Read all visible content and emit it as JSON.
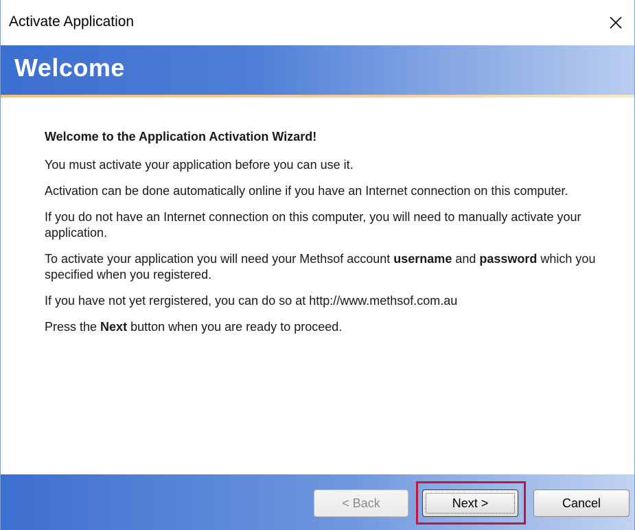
{
  "window": {
    "title": "Activate Application",
    "close_icon": "close-icon"
  },
  "banner": {
    "title": "Welcome"
  },
  "content": {
    "heading": "Welcome to the Application Activation Wizard!",
    "p1": "You must activate your application before you can use it.",
    "p2": "Activation can be done automatically online if you have an Internet connection on this computer.",
    "p3": "If you do not have an Internet connection on this computer, you will need to manually activate your application.",
    "p4_part1": "To activate your application you will need your Methsof account ",
    "p4_bold1": "username",
    "p4_part2": " and ",
    "p4_bold2": "password",
    "p4_part3": " which you specified when you registered.",
    "p5": "If you have not yet rergistered, you can do so at http://www.methsof.com.au",
    "p6_part1": "Press the ",
    "p6_bold": "Next",
    "p6_part2": " button when you are ready to proceed."
  },
  "footer": {
    "back_label": "< Back",
    "next_label": "Next >",
    "cancel_label": "Cancel"
  },
  "colors": {
    "banner": "#3b6fd0",
    "accent_rule": "#f7c07a",
    "highlight": "#c0173b"
  }
}
